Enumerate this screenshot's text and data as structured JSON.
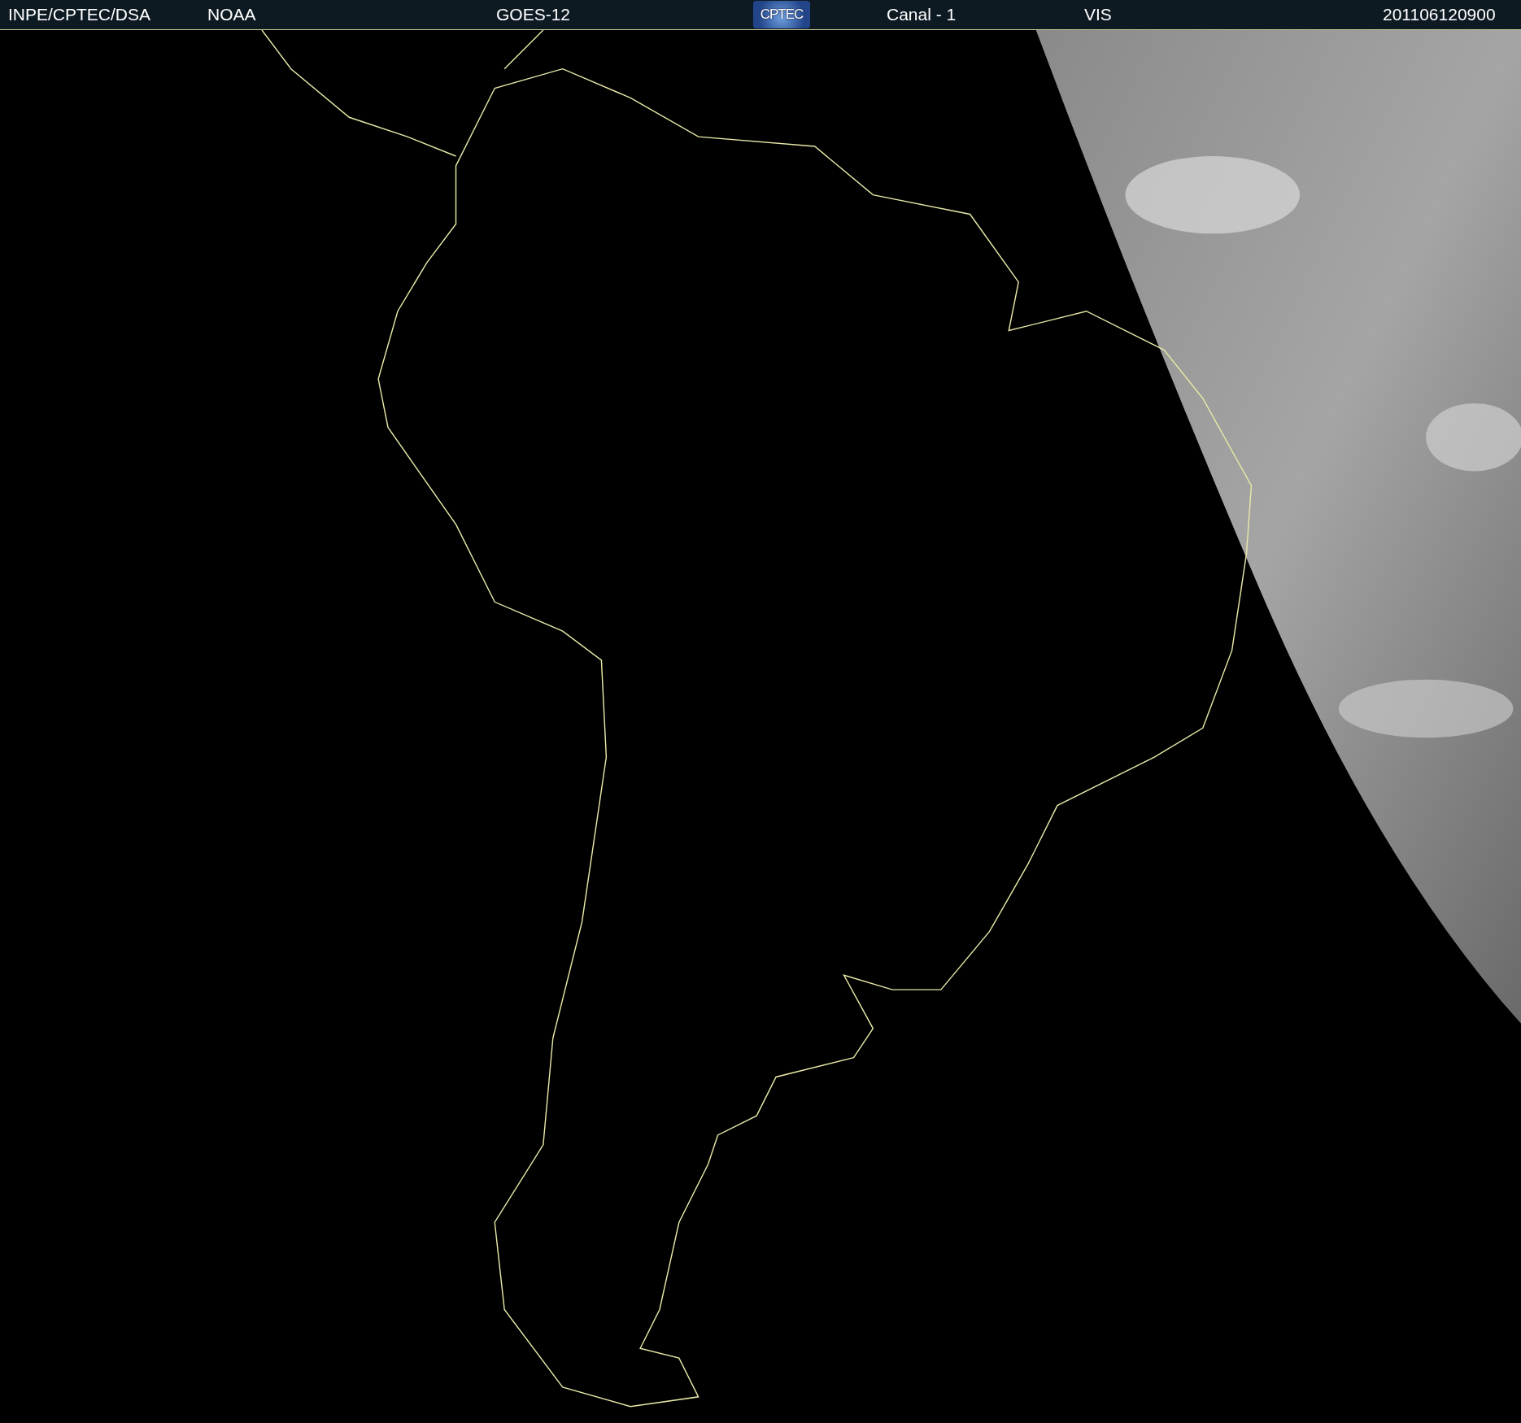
{
  "header": {
    "items": [
      {
        "kind": "text",
        "text": "INPE/CPTEC/DSA"
      },
      {
        "kind": "text",
        "text": "NOAA"
      },
      {
        "kind": "text",
        "text": "GOES-12"
      },
      {
        "kind": "logo",
        "text": "CPTEC"
      },
      {
        "kind": "text",
        "text": "Canal - 1"
      },
      {
        "kind": "text",
        "text": "VIS"
      },
      {
        "kind": "text",
        "text": "201106120900"
      }
    ]
  }
}
